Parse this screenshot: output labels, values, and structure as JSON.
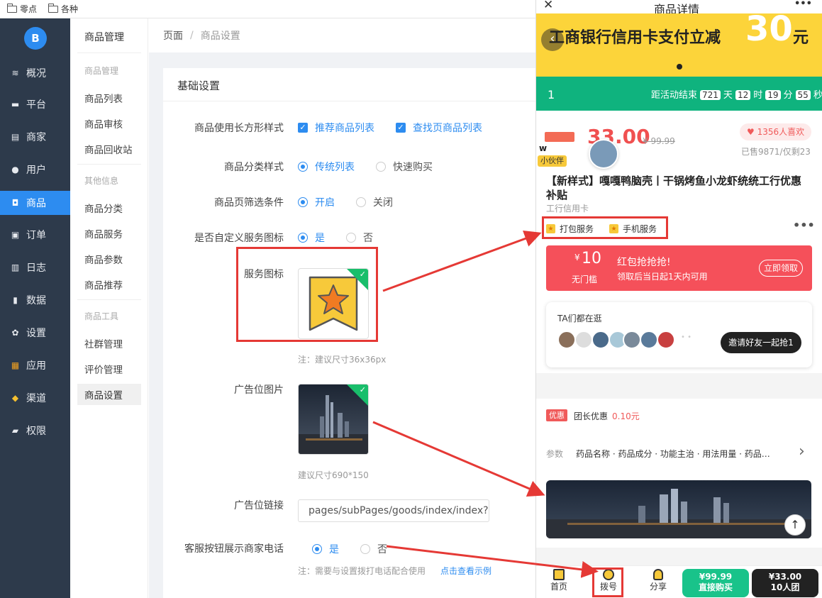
{
  "bookmarks": [
    {
      "label": "零点"
    },
    {
      "label": "各种"
    }
  ],
  "sidebar": {
    "logo": "B",
    "items": [
      {
        "label": "概况",
        "icon": "dashboard-icon",
        "glyph": "≋"
      },
      {
        "label": "平台",
        "icon": "monitor-icon",
        "glyph": "▬"
      },
      {
        "label": "商家",
        "icon": "store-icon",
        "glyph": "▤"
      },
      {
        "label": "用户",
        "icon": "user-icon",
        "glyph": "●"
      },
      {
        "label": "商品",
        "icon": "bag-icon",
        "glyph": "◘"
      },
      {
        "label": "订单",
        "icon": "order-icon",
        "glyph": "▣"
      },
      {
        "label": "日志",
        "icon": "book-icon",
        "glyph": "▥"
      },
      {
        "label": "数据",
        "icon": "chart-icon",
        "glyph": "▮"
      },
      {
        "label": "设置",
        "icon": "gear-icon",
        "glyph": "✿"
      },
      {
        "label": "应用",
        "icon": "apps-icon",
        "glyph": "▦"
      },
      {
        "label": "渠道",
        "icon": "cube-icon",
        "glyph": "◆"
      },
      {
        "label": "权限",
        "icon": "lock-icon",
        "glyph": "▰"
      }
    ]
  },
  "subnav": {
    "title": "商品管理",
    "groups": [
      {
        "label": "商品管理",
        "items": [
          "商品列表",
          "商品审核",
          "商品回收站"
        ]
      },
      {
        "label": "其他信息",
        "items": [
          "商品分类",
          "商品服务",
          "商品参数",
          "商品推荐"
        ]
      },
      {
        "label": "商品工具",
        "items": [
          "社群管理",
          "评价管理",
          "商品设置"
        ]
      }
    ]
  },
  "breadcrumb": {
    "home": "页面",
    "sep": "/",
    "current": "商品设置"
  },
  "form": {
    "card_title": "基础设置",
    "rect_style": {
      "label": "商品使用长方形样式",
      "opt1": "推荐商品列表",
      "opt2": "查找页商品列表"
    },
    "category_style": {
      "label": "商品分类样式",
      "opt1": "传统列表",
      "opt2": "快速购买"
    },
    "filter": {
      "label": "商品页筛选条件",
      "opt1": "开启",
      "opt2": "关闭"
    },
    "custom_icon": {
      "label": "是否自定义服务图标",
      "opt1": "是",
      "opt2": "否"
    },
    "service_icon": {
      "label": "服务图标",
      "note": "注：建议尺寸36x36px"
    },
    "ad_image": {
      "label": "广告位图片",
      "note": "建议尺寸690*150"
    },
    "ad_link": {
      "label": "广告位链接",
      "value": "pages/subPages/goods/index/index?g"
    },
    "phone_btn": {
      "label": "客服按钮展示商家电话",
      "opt1": "是",
      "opt2": "否",
      "note": "注：需要与设置拨打电话配合使用",
      "link": "点击查看示例"
    }
  },
  "phone": {
    "title": "商品详情",
    "close": "✕",
    "more": "•••",
    "banner_text": "工商银行信用卡支付立减",
    "banner_num": "30",
    "banner_unit": "元",
    "count": {
      "index": "1",
      "label": "距活动结束",
      "days": "721",
      "d": "天",
      "hours": "12",
      "h": "时",
      "mins": "19",
      "m": "分",
      "secs": "55",
      "s": "秒"
    },
    "price": "33.00",
    "orig_price": "¥ 99.99",
    "likes": "1356人喜欢",
    "sold": "已售9871/仅剩23",
    "buddy_initial": "w",
    "buddy_tag": "小伙伴",
    "product_title": "【新样式】嘎嘎鸭脑壳丨干锅烤鱼小龙虾统统工行优惠补贴",
    "product_sub": "工行信用卡",
    "services": [
      "打包服务",
      "手机服务"
    ],
    "coupon": {
      "amount": "10",
      "currency": "¥",
      "cond": "无门槛",
      "title": "红包抢抢抢!",
      "desc": "领取后当日起1天内可用",
      "btn": "立即领取"
    },
    "friends": {
      "title": "TA们都在逛",
      "btn": "邀请好友一起抢1"
    },
    "promo": {
      "tag": "优惠",
      "text": "团长优惠",
      "value": "0.10元"
    },
    "params": {
      "label": "参数",
      "text": "药品名称 · 药品成分 · 功能主治 · 用法用量 · 药品…"
    },
    "tabs": [
      {
        "label": "首页"
      },
      {
        "label": "拨号"
      },
      {
        "label": "分享"
      }
    ],
    "buy_direct": {
      "price": "¥99.99",
      "label": "直接购买"
    },
    "buy_group": {
      "price": "¥33.00",
      "label": "10人团"
    }
  },
  "colors": {
    "accent": "#2d8cf0",
    "sidebar": "#2d3a4b",
    "annotation": "#e53935",
    "green": "#0fb37e"
  }
}
